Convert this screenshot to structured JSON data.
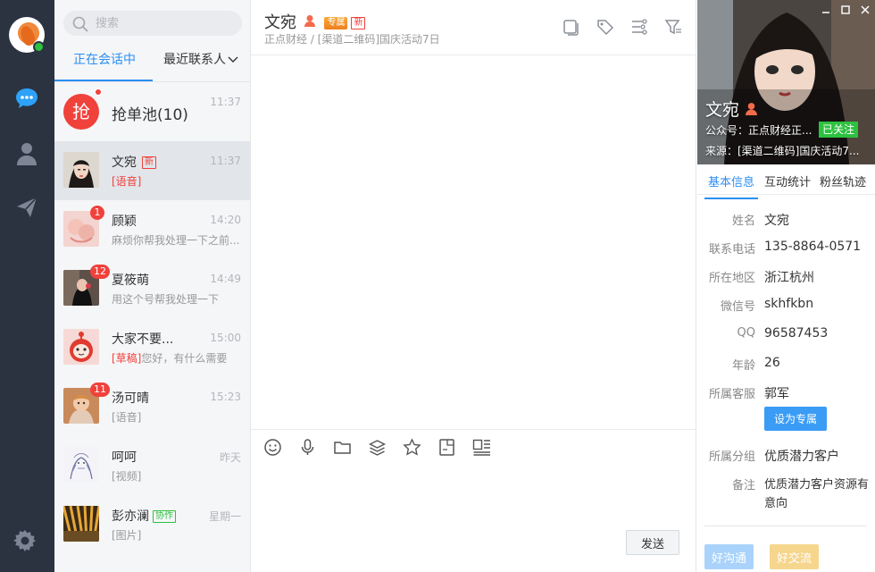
{
  "search": {
    "placeholder": "搜索"
  },
  "list_tabs": {
    "active": "正在会话中",
    "other": "最近联系人"
  },
  "pool": {
    "icon_text": "抢",
    "name": "抢单池(10)",
    "time": "11:37"
  },
  "conversations": [
    {
      "name": "文宛",
      "chip": "新",
      "time": "11:37",
      "preview_tag": "[语音]",
      "preview": "",
      "badge": "",
      "active": true
    },
    {
      "name": "顾颖",
      "chip": "",
      "time": "14:20",
      "preview_tag": "",
      "preview": "麻烦你帮我处理一下之前...",
      "badge": "1"
    },
    {
      "name": "夏筱萌",
      "chip": "",
      "time": "14:49",
      "preview_tag": "",
      "preview": "用这个号帮我处理一下",
      "badge": "12"
    },
    {
      "name": "大家不要...",
      "chip": "",
      "time": "15:00",
      "preview_tag": "[草稿]",
      "preview": "您好，有什么需要",
      "badge": ""
    },
    {
      "name": "汤可晴",
      "chip": "",
      "time": "15:23",
      "preview_tag": "",
      "preview": "[语音]",
      "badge": "11"
    },
    {
      "name": "呵呵",
      "chip": "",
      "time": "昨天",
      "preview_tag": "",
      "preview": "[视频]",
      "badge": ""
    },
    {
      "name": "彭亦澜",
      "chip": "协作",
      "time": "星期一",
      "preview_tag": "",
      "preview": "[图片]",
      "badge": ""
    }
  ],
  "chat": {
    "title": "文宛",
    "chip_exclusive": "专属",
    "chip_new": "新",
    "subtitle": "正点财经 / [渠道二维码]国庆活动7日",
    "send_label": "发送"
  },
  "profile": {
    "name": "文宛",
    "official_account": "公众号：正点财经正...",
    "followed": "已关注",
    "source": "来源：[渠道二维码]国庆活动7...",
    "tabs": [
      "基本信息",
      "互动统计",
      "粉丝轨迹"
    ],
    "fields": [
      {
        "k": "姓名",
        "v": "文宛"
      },
      {
        "k": "联系电话",
        "v": "135-8864-0571"
      },
      {
        "k": "所在地区",
        "v": "浙江杭州"
      },
      {
        "k": "微信号",
        "v": "skhfkbn"
      },
      {
        "k": "QQ",
        "v": "96587453"
      },
      {
        "k": "年龄",
        "v": "26"
      },
      {
        "k": "所属客服",
        "v": "郭军"
      }
    ],
    "assign_label": "设为专属",
    "group_label": "所属分组",
    "group_value": "优质潜力客户",
    "note_label": "备注",
    "note_value": "优质潜力客户资源有意向",
    "tags": [
      "好沟通",
      "好交流"
    ]
  },
  "colors": {
    "accent": "#2b8ef2",
    "badge": "#f0413b",
    "rail": "#2b3340",
    "online": "#2cc13e"
  }
}
